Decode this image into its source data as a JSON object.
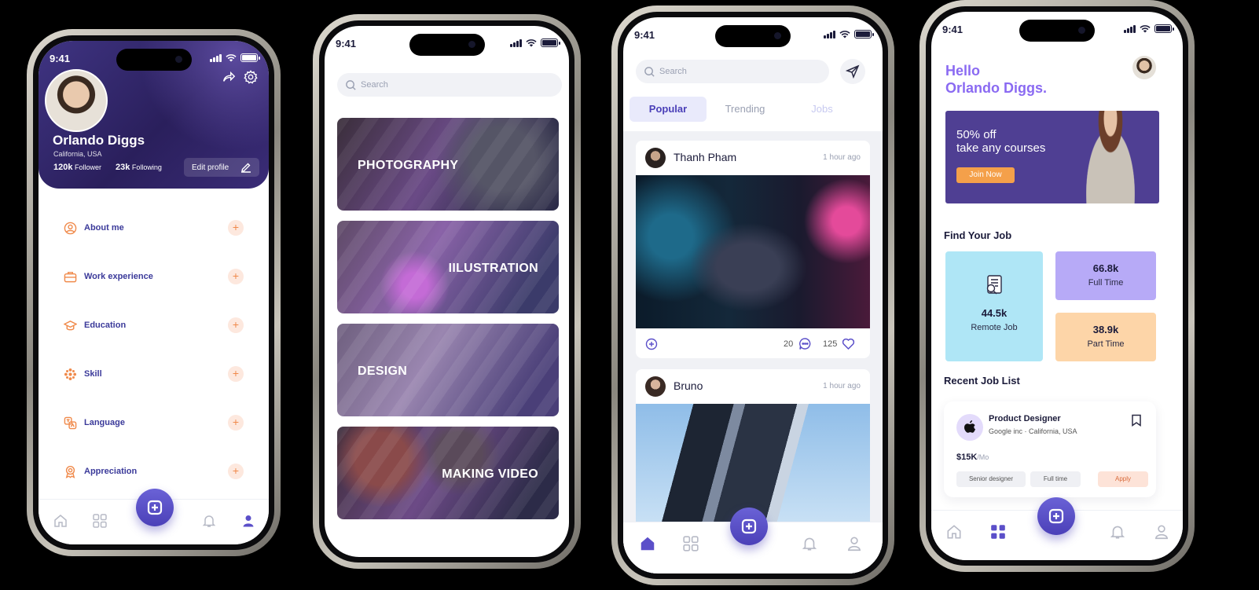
{
  "status_time": "9:41",
  "profile": {
    "name": "Orlando Diggs",
    "location": "California, USA",
    "followers_count": "120k",
    "followers_label": "Follower",
    "following_count": "23k",
    "following_label": "Following",
    "edit_label": "Edit profile",
    "menu": [
      {
        "label": "About me",
        "icon": "user-circle-icon"
      },
      {
        "label": "Work experience",
        "icon": "briefcase-icon"
      },
      {
        "label": "Education",
        "icon": "graduation-cap-icon"
      },
      {
        "label": "Skill",
        "icon": "skill-icon"
      },
      {
        "label": "Language",
        "icon": "language-icon"
      },
      {
        "label": "Appreciation",
        "icon": "award-icon"
      }
    ],
    "plus_glyph": "+"
  },
  "explore": {
    "search_placeholder": "Search",
    "categories": [
      {
        "label": "PHOTOGRAPHY"
      },
      {
        "label": "IILUSTRATION"
      },
      {
        "label": "DESIGN"
      },
      {
        "label": "MAKING VIDEO"
      }
    ]
  },
  "feed": {
    "search_placeholder": "Search",
    "tabs": [
      "Popular",
      "Trending",
      "Jobs"
    ],
    "posts": [
      {
        "author": "Thanh Pham",
        "time": "1 hour ago",
        "comments": "20",
        "likes": "125"
      },
      {
        "author": "Bruno",
        "time": "1 hour ago"
      }
    ]
  },
  "jobs": {
    "greeting_line1": "Hello",
    "greeting_line2": "Orlando Diggs.",
    "promo_line1": "50% off",
    "promo_line2": "take any courses",
    "promo_button": "Join Now",
    "find_title": "Find Your Job",
    "remote_count": "44.5k",
    "remote_label": "Remote Job",
    "fulltime_count": "66.8k",
    "fulltime_label": "Full Time",
    "parttime_count": "38.9k",
    "parttime_label": "Part Time",
    "recent_title": "Recent Job List",
    "job": {
      "title": "Product Designer",
      "company": "Google inc · California, USA",
      "salary": "$15K",
      "salary_unit": "/Mo",
      "tag1": "Senior designer",
      "tag2": "Full time",
      "apply": "Apply"
    }
  },
  "colors": {
    "accent": "#5b4fc9",
    "orange": "#f08a4b",
    "lilac": "#8a6af2",
    "remote_card": "#afe6f6",
    "fulltime_card": "#b7aaf7",
    "parttime_card": "#fdd5a8"
  }
}
